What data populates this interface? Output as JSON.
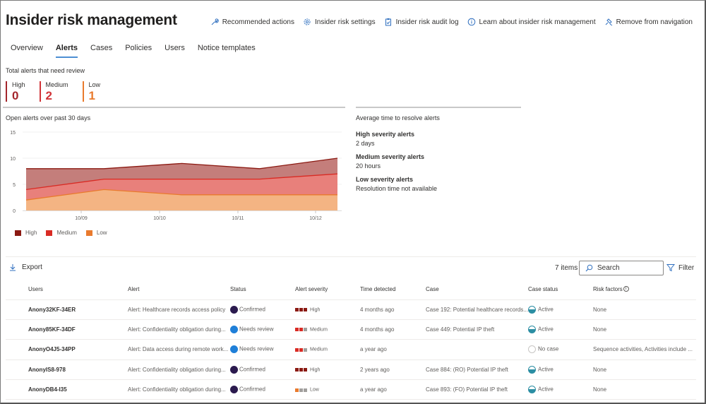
{
  "header": {
    "title": "Insider risk management",
    "actions": [
      {
        "label": "Recommended actions",
        "icon": "wrench-icon"
      },
      {
        "label": "Insider risk settings",
        "icon": "gear-icon"
      },
      {
        "label": "Insider risk audit log",
        "icon": "clipboard-icon"
      },
      {
        "label": "Learn about insider risk management",
        "icon": "info-icon"
      },
      {
        "label": "Remove from navigation",
        "icon": "unpin-icon"
      }
    ]
  },
  "tabs": [
    {
      "label": "Overview",
      "active": false
    },
    {
      "label": "Alerts",
      "active": true
    },
    {
      "label": "Cases",
      "active": false
    },
    {
      "label": "Policies",
      "active": false
    },
    {
      "label": "Users",
      "active": false
    },
    {
      "label": "Notice templates",
      "active": false
    }
  ],
  "summary": {
    "title": "Total alerts that need review",
    "counts": [
      {
        "label": "High",
        "value": "0",
        "color": "#a4262c"
      },
      {
        "label": "Medium",
        "value": "2",
        "color": "#d13438"
      },
      {
        "label": "Low",
        "value": "1",
        "color": "#e97a2d"
      }
    ]
  },
  "chart_data": {
    "type": "area",
    "stacked": true,
    "title": "Open alerts over past 30 days",
    "xlabel": "",
    "ylabel": "",
    "ylim": [
      0,
      15
    ],
    "yticks": [
      "0",
      "5",
      "10",
      "15"
    ],
    "xticks": [
      "10/09",
      "10/10",
      "10/11",
      "10/12"
    ],
    "x": [
      0,
      1,
      2,
      3,
      4
    ],
    "grid": true,
    "legend_position": "bottom-left",
    "series": [
      {
        "name": "Low",
        "values": [
          2,
          4,
          3,
          3,
          3
        ],
        "color": "#e97a2d",
        "fill": "#f4b483"
      },
      {
        "name": "Medium",
        "values": [
          2,
          2,
          3,
          3,
          4
        ],
        "color": "#d92b24",
        "fill": "#e8807b"
      },
      {
        "name": "High",
        "values": [
          4,
          2,
          3,
          2,
          3
        ],
        "color": "#8b1a12",
        "fill": "#c47e7b"
      }
    ],
    "legend": [
      {
        "name": "High",
        "color": "#8b1a12"
      },
      {
        "name": "Medium",
        "color": "#d92b24"
      },
      {
        "name": "Low",
        "color": "#e97a2d"
      }
    ]
  },
  "resolve": {
    "title": "Average time to resolve alerts",
    "items": [
      {
        "label": "High severity alerts",
        "value": "2 days"
      },
      {
        "label": "Medium severity alerts",
        "value": "20 hours"
      },
      {
        "label": "Low severity alerts",
        "value": "Resolution time not available"
      }
    ]
  },
  "toolbar": {
    "export_label": "Export",
    "items_count": "7 items",
    "search_placeholder": "Search",
    "filter_label": "Filter"
  },
  "table": {
    "columns": [
      "Users",
      "Alert",
      "Status",
      "Alert severity",
      "Time detected",
      "Case",
      "Case status",
      "Risk factors"
    ],
    "rows": [
      {
        "user": "Anony32KF-34ER",
        "alert": "Alert: Healthcare records access policy",
        "status": "Confirmed",
        "severity": "High",
        "time": "4 months ago",
        "case": "Case 192: Potential healthcare records...",
        "case_status": "Active",
        "risk": "None"
      },
      {
        "user": "Anony85KF-34DF",
        "alert": "Alert: Confidentiality obligation during...",
        "status": "Needs review",
        "severity": "Medium",
        "time": "4 months ago",
        "case": "Case 449: Potential IP theft",
        "case_status": "Active",
        "risk": "None"
      },
      {
        "user": "AnonyO4J5-34PP",
        "alert": "Alert: Data access during remote work...",
        "status": "Needs review",
        "severity": "Medium",
        "time": "a year ago",
        "case": "",
        "case_status": "No case",
        "risk": "Sequence activities, Activities include ..."
      },
      {
        "user": "AnonyIS8-978",
        "alert": "Alert: Confidentiality obligation during...",
        "status": "Confirmed",
        "severity": "High",
        "time": "2 years ago",
        "case": "Case 884: (RO) Potential IP theft",
        "case_status": "Active",
        "risk": "None"
      },
      {
        "user": "AnonyDB4-I35",
        "alert": "Alert: Confidentiality obligation during...",
        "status": "Confirmed",
        "severity": "Low",
        "time": "a year ago",
        "case": "Case 893: (FO) Potential IP theft",
        "case_status": "Active",
        "risk": "None"
      }
    ]
  },
  "colors": {
    "confirmed": "#2b1a4e",
    "needs_review": "#1f7fd8",
    "active_case": "#2c8ea3",
    "sev_high": "#8b1a12",
    "sev_medium": "#d92b24",
    "sev_low": "#e97a2d",
    "sev_off": "#a19f9d"
  }
}
